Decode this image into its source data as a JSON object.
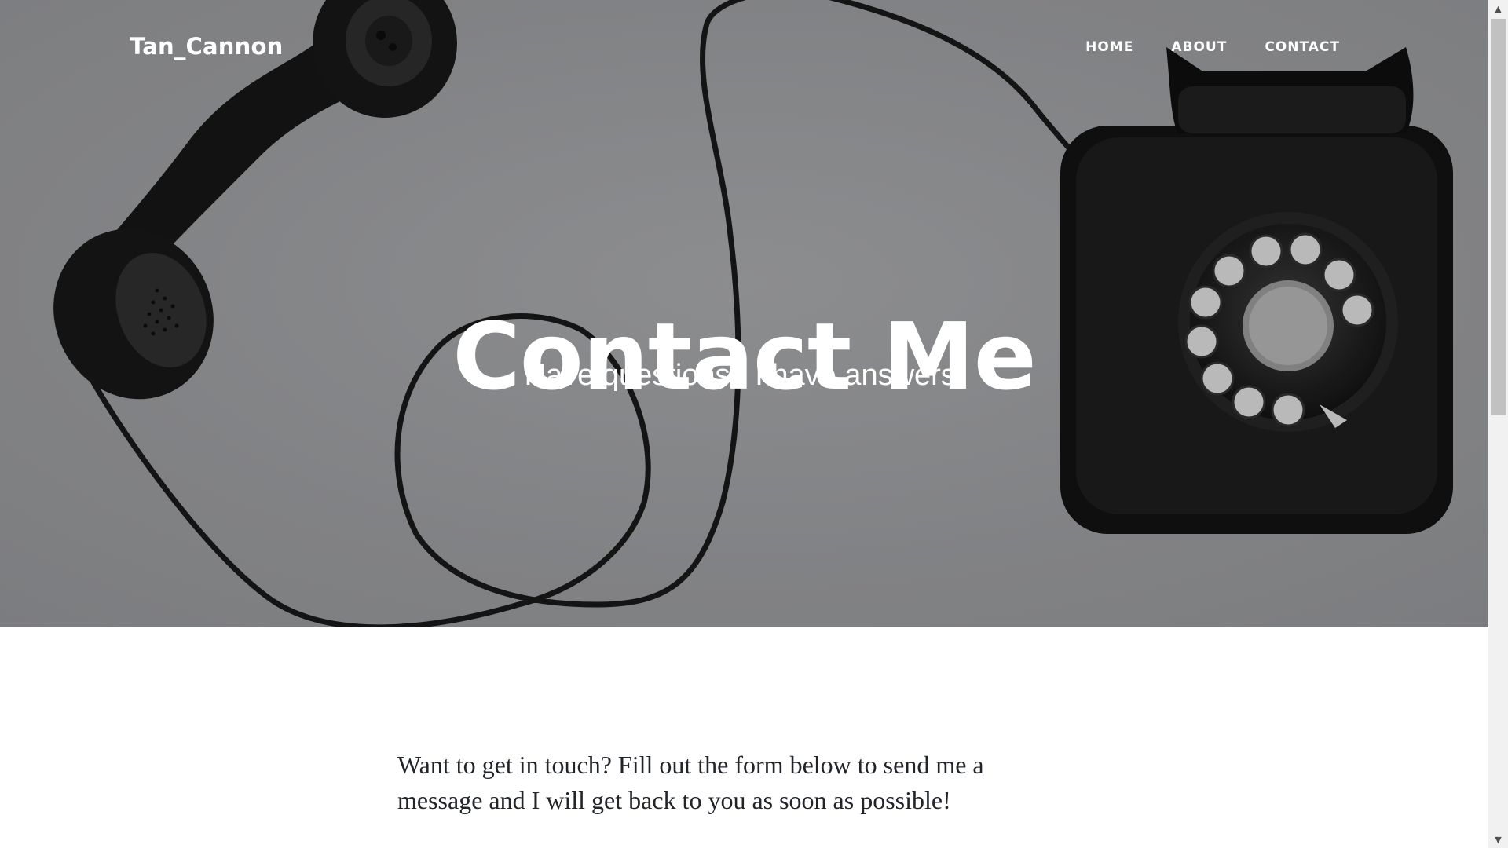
{
  "navbar": {
    "brand": "Tan_Cannon",
    "links": [
      {
        "label": "HOME"
      },
      {
        "label": "ABOUT"
      },
      {
        "label": "CONTACT"
      }
    ]
  },
  "hero": {
    "heading": "Contact Me",
    "subheading": "Have questions? I have answers.",
    "background_color": "#8c8d8f"
  },
  "main": {
    "intro": "Want to get in touch? Fill out the form below to send me a message and I will get back to you as soon as possible!"
  },
  "scrollbar": {
    "up_icon": "triangle-up-icon",
    "down_icon": "triangle-down-icon"
  }
}
